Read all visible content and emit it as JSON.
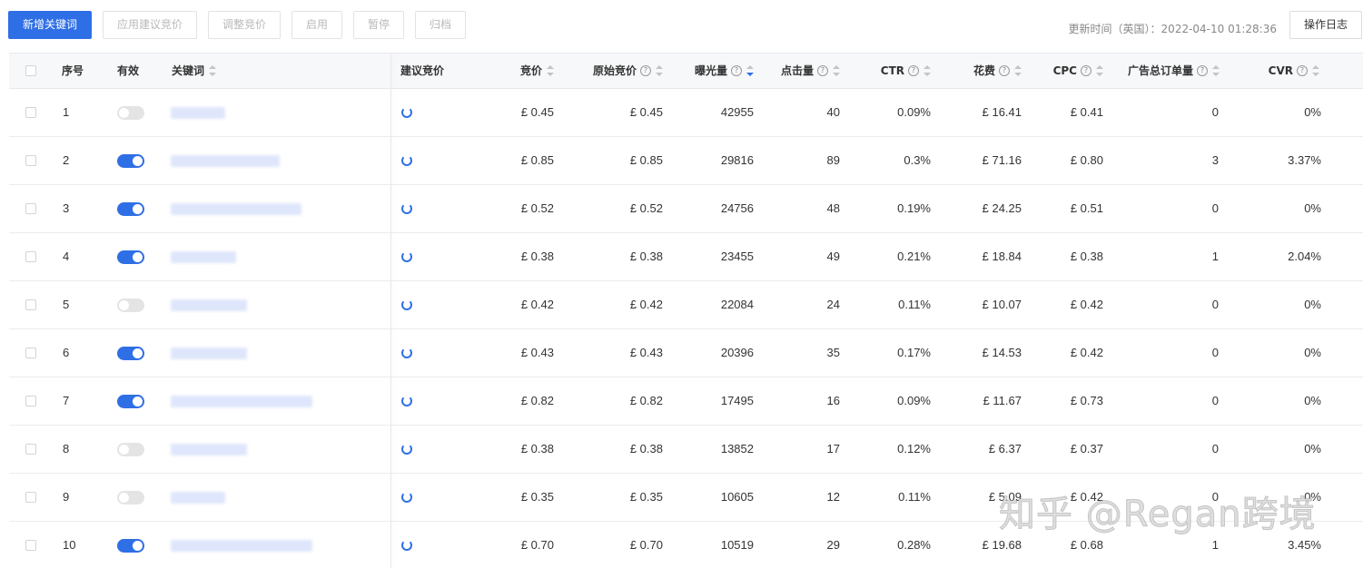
{
  "toolbar": {
    "buttons": {
      "add_keyword": "新增关键词",
      "apply_suggested_bid": "应用建议竞价",
      "adjust_bid": "调整竞价",
      "enable": "启用",
      "pause": "暂停",
      "archive": "归档"
    },
    "update_time": "更新时间（英国）：2022-04-10 01:28:36",
    "operation_log": "操作日志"
  },
  "table": {
    "headers": {
      "index": "序号",
      "active": "有效",
      "keyword": "关键词",
      "suggested_bid": "建议竞价",
      "bid": "竞价",
      "original_bid": "原始竞价",
      "impressions": "曝光量",
      "clicks": "点击量",
      "ctr": "CTR",
      "spend": "花费",
      "cpc": "CPC",
      "total_orders": "广告总订单量",
      "cvr": "CVR"
    },
    "rows": [
      {
        "index": "1",
        "active": false,
        "bid": "£ 0.45",
        "original_bid": "£ 0.45",
        "impressions": "42955",
        "clicks": "40",
        "ctr": "0.09%",
        "spend": "£ 16.41",
        "cpc": "£ 0.41",
        "orders": "0",
        "cvr": "0%"
      },
      {
        "index": "2",
        "active": true,
        "bid": "£ 0.85",
        "original_bid": "£ 0.85",
        "impressions": "29816",
        "clicks": "89",
        "ctr": "0.3%",
        "spend": "£ 71.16",
        "cpc": "£ 0.80",
        "orders": "3",
        "cvr": "3.37%"
      },
      {
        "index": "3",
        "active": true,
        "bid": "£ 0.52",
        "original_bid": "£ 0.52",
        "impressions": "24756",
        "clicks": "48",
        "ctr": "0.19%",
        "spend": "£ 24.25",
        "cpc": "£ 0.51",
        "orders": "0",
        "cvr": "0%"
      },
      {
        "index": "4",
        "active": true,
        "bid": "£ 0.38",
        "original_bid": "£ 0.38",
        "impressions": "23455",
        "clicks": "49",
        "ctr": "0.21%",
        "spend": "£ 18.84",
        "cpc": "£ 0.38",
        "orders": "1",
        "cvr": "2.04%"
      },
      {
        "index": "5",
        "active": false,
        "bid": "£ 0.42",
        "original_bid": "£ 0.42",
        "impressions": "22084",
        "clicks": "24",
        "ctr": "0.11%",
        "spend": "£ 10.07",
        "cpc": "£ 0.42",
        "orders": "0",
        "cvr": "0%"
      },
      {
        "index": "6",
        "active": true,
        "bid": "£ 0.43",
        "original_bid": "£ 0.43",
        "impressions": "20396",
        "clicks": "35",
        "ctr": "0.17%",
        "spend": "£ 14.53",
        "cpc": "£ 0.42",
        "orders": "0",
        "cvr": "0%"
      },
      {
        "index": "7",
        "active": true,
        "bid": "£ 0.82",
        "original_bid": "£ 0.82",
        "impressions": "17495",
        "clicks": "16",
        "ctr": "0.09%",
        "spend": "£ 11.67",
        "cpc": "£ 0.73",
        "orders": "0",
        "cvr": "0%"
      },
      {
        "index": "8",
        "active": false,
        "bid": "£ 0.38",
        "original_bid": "£ 0.38",
        "impressions": "13852",
        "clicks": "17",
        "ctr": "0.12%",
        "spend": "£ 6.37",
        "cpc": "£ 0.37",
        "orders": "0",
        "cvr": "0%"
      },
      {
        "index": "9",
        "active": false,
        "bid": "£ 0.35",
        "original_bid": "£ 0.35",
        "impressions": "10605",
        "clicks": "12",
        "ctr": "0.11%",
        "spend": "£ 5.09",
        "cpc": "£ 0.42",
        "orders": "0",
        "cvr": "0%"
      },
      {
        "index": "10",
        "active": true,
        "bid": "£ 0.70",
        "original_bid": "£ 0.70",
        "impressions": "10519",
        "clicks": "29",
        "ctr": "0.28%",
        "spend": "£ 19.68",
        "cpc": "£ 0.68",
        "orders": "1",
        "cvr": "3.45%"
      }
    ]
  },
  "watermark": "知乎 @Regan跨境",
  "colors": {
    "primary": "#2f6fe6",
    "toggle_off": "#e4e4e4",
    "header_bg": "#f7f8fa"
  }
}
